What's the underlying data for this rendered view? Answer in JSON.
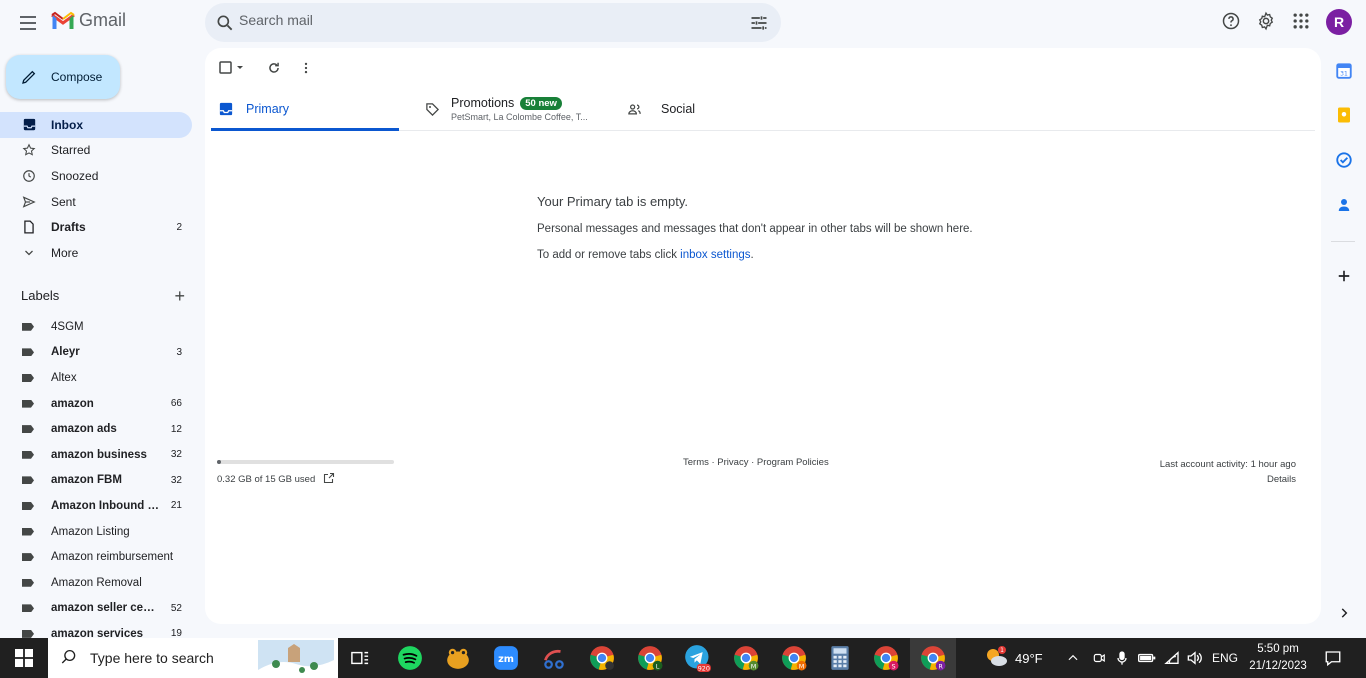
{
  "app": {
    "name": "Gmail",
    "avatar_letter": "R",
    "accent": "#0b57d0"
  },
  "search": {
    "placeholder": "Search mail"
  },
  "compose": {
    "label": "Compose"
  },
  "nav": [
    {
      "label": "Inbox",
      "icon": "inbox-icon",
      "count": "",
      "active": true,
      "bold": true
    },
    {
      "label": "Starred",
      "icon": "star-icon",
      "count": "",
      "active": false,
      "bold": false
    },
    {
      "label": "Snoozed",
      "icon": "clock-icon",
      "count": "",
      "active": false,
      "bold": false
    },
    {
      "label": "Sent",
      "icon": "send-icon",
      "count": "",
      "active": false,
      "bold": false
    },
    {
      "label": "Drafts",
      "icon": "draft-icon",
      "count": "2",
      "active": false,
      "bold": true
    },
    {
      "label": "More",
      "icon": "chevron-down-icon",
      "count": "",
      "active": false,
      "bold": false
    }
  ],
  "labels_header": "Labels",
  "labels": [
    {
      "name": "4SGM",
      "count": "",
      "bold": false
    },
    {
      "name": "Aleyr",
      "count": "3",
      "bold": true
    },
    {
      "name": "Altex",
      "count": "",
      "bold": false
    },
    {
      "name": "amazon",
      "count": "66",
      "bold": true
    },
    {
      "name": "amazon ads",
      "count": "12",
      "bold": true
    },
    {
      "name": "amazon business",
      "count": "32",
      "bold": true
    },
    {
      "name": "amazon FBM",
      "count": "32",
      "bold": true
    },
    {
      "name": "Amazon Inbound S...",
      "count": "21",
      "bold": true
    },
    {
      "name": "Amazon Listing",
      "count": "",
      "bold": false
    },
    {
      "name": "Amazon reimbursement",
      "count": "",
      "bold": false
    },
    {
      "name": "Amazon Removal",
      "count": "",
      "bold": false
    },
    {
      "name": "amazon seller cen...",
      "count": "52",
      "bold": true
    },
    {
      "name": "amazon services",
      "count": "19",
      "bold": true
    }
  ],
  "tabs": {
    "primary": "Primary",
    "promotions": "Promotions",
    "promotions_badge": "50 new",
    "promotions_sub": "PetSmart, La Colombe Coffee, T...",
    "social": "Social"
  },
  "empty_state": {
    "title": "Your Primary tab is empty.",
    "line1": "Personal messages and messages that don't appear in other tabs will be shown here.",
    "line2_prefix": "To add or remove tabs click ",
    "line2_link": "inbox settings",
    "line2_suffix": "."
  },
  "footer": {
    "storage_text": "0.32 GB of 15 GB used",
    "storage_fraction": 0.021,
    "links": "Terms · Privacy · Program Policies",
    "activity": "Last account activity: 1 hour ago",
    "details": "Details"
  },
  "taskbar": {
    "search_placeholder": "Type here to search",
    "weather": "49°F",
    "lang": "ENG",
    "time": "5:50 pm",
    "date": "21/12/2023",
    "telegram_badge": "920"
  }
}
